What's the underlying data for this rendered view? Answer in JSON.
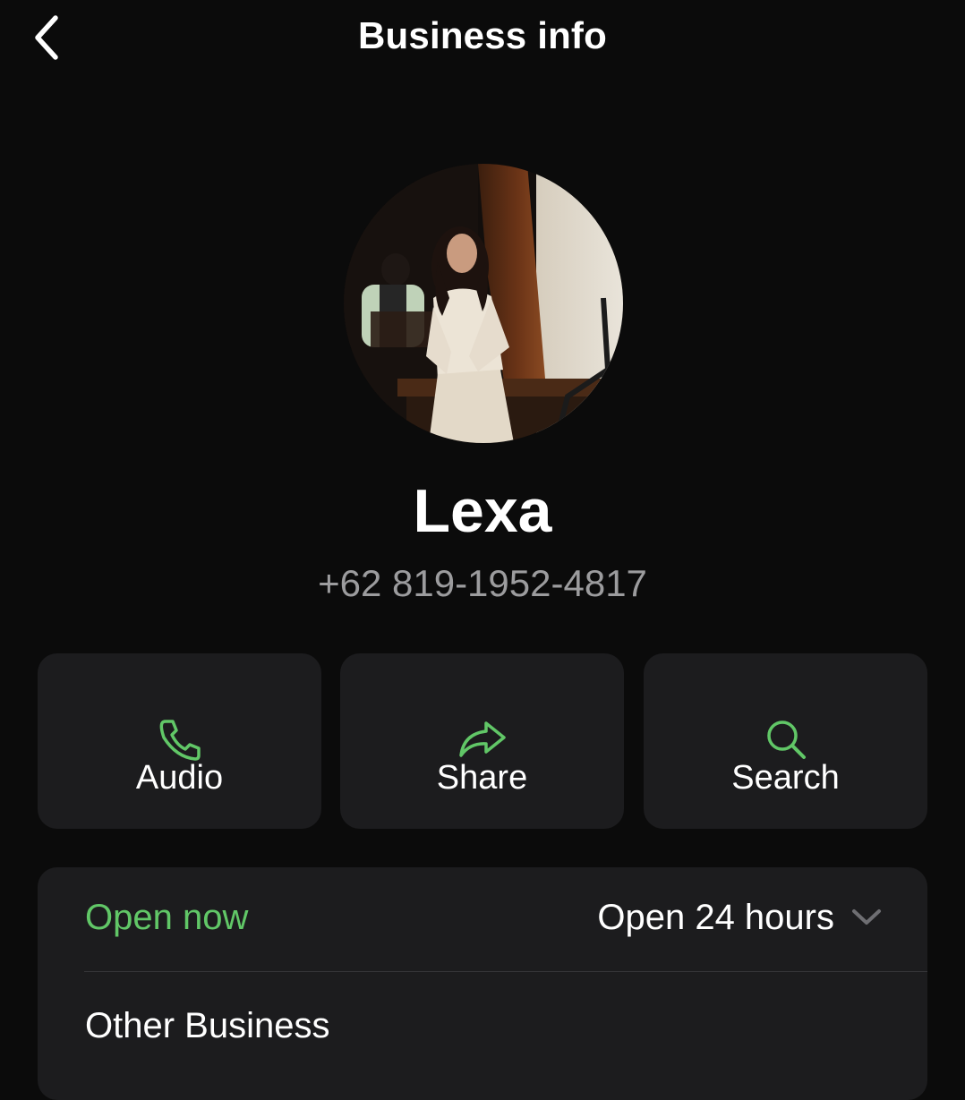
{
  "header": {
    "title": "Business info",
    "back_icon": "chevron-left-icon"
  },
  "profile": {
    "name": "Lexa",
    "phone": "+62 819-1952-4817",
    "avatar_description": "profile-photo"
  },
  "actions": [
    {
      "label": "Audio",
      "icon": "phone-icon"
    },
    {
      "label": "Share",
      "icon": "share-arrow-icon"
    },
    {
      "label": "Search",
      "icon": "search-icon"
    }
  ],
  "business_hours": {
    "status": "Open now",
    "hours": "Open 24 hours",
    "expand_icon": "chevron-down-icon"
  },
  "category": "Other Business",
  "colors": {
    "background": "#0b0b0b",
    "card": "#1c1c1e",
    "accent_green": "#61c767",
    "secondary_text": "#9c9c9e"
  }
}
